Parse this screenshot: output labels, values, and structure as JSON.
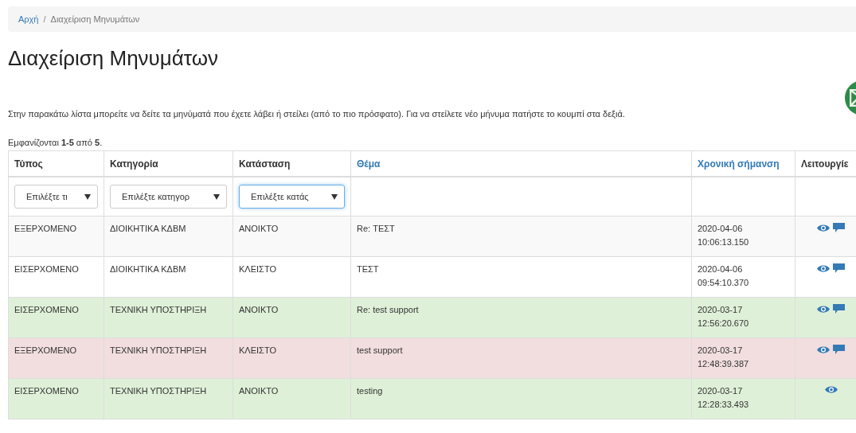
{
  "breadcrumb": [
    {
      "label": "Αρχή",
      "selected": false
    },
    {
      "label": "Διαχείριση Μηνυμάτων",
      "selected": true
    }
  ],
  "breadcrumb_separator": "/",
  "title": "Διαχείριση Μηνυμάτων",
  "intro": "Στην παρακάτω λίστα μπορείτε να δείτε τα μηνύματά που έχετε λάβει ή στείλει (από το πιο πρόσφατο). Για να στείλετε νέο μήνυμα πατήστε το κουμπί στα δεξιά.",
  "summary": "Εμφανίζονται **1-5** από **5**.",
  "table": {
    "columns": [
      {
        "label": "Τύπος",
        "sortable": false
      },
      {
        "label": "Κατηγορία",
        "sortable": false
      },
      {
        "label": "Κατάσταση",
        "sortable": false
      },
      {
        "label": "Θέμα",
        "sortable": true
      },
      {
        "label": "Χρονική σήμανση",
        "sortable": true
      },
      {
        "label": "Λειτουργίε",
        "sortable": false
      }
    ],
    "filters": [
      {
        "placeholder": "Επιλέξτε τι",
        "focused": false
      },
      {
        "placeholder": "Επιλέξτε κατηγορ",
        "focused": false
      },
      {
        "placeholder": "Επιλέξτε κατάς",
        "focused": true
      }
    ],
    "rows": [
      {
        "color": "#f9f9f9",
        "cells": [
          "ΕΞΕΡΧΟΜΕΝΟ",
          "ΔΙΟΙΚΗΤΙΚΑ ΚΔΒΜ",
          "ΑΝΟΙΚΤΟ",
          "Re: ΤΕΣΤ"
        ],
        "date": "2020-04-06",
        "time": "10:06:13.150",
        "actions": [
          {
            "kind": "view"
          },
          {
            "kind": "reply"
          }
        ]
      },
      {
        "color": "#ffffff",
        "cells": [
          "ΕΙΣΕΡΧΟΜΕΝΟ",
          "ΔΙΟΙΚΗΤΙΚΑ ΚΔΒΜ",
          "ΚΛΕΙΣΤΟ",
          "ΤΕΣΤ"
        ],
        "date": "2020-04-06",
        "time": "09:54:10.370",
        "actions": [
          {
            "kind": "view"
          },
          {
            "kind": "reply"
          }
        ]
      },
      {
        "color": "#dff0d8",
        "cells": [
          "ΕΙΣΕΡΧΟΜΕΝΟ",
          "ΤΕΧΝΙΚΗ ΥΠΟΣΤΗΡΙΞΗ",
          "ΑΝΟΙΚΤΟ",
          "Re: test support"
        ],
        "date": "2020-03-17",
        "time": "12:56:20.670",
        "actions": [
          {
            "kind": "view"
          },
          {
            "kind": "reply"
          }
        ]
      },
      {
        "color": "#f2dede",
        "cells": [
          "ΕΞΕΡΧΟΜΕΝΟ",
          "ΤΕΧΝΙΚΗ ΥΠΟΣΤΗΡΙΞΗ",
          "ΚΛΕΙΣΤΟ",
          "test support"
        ],
        "date": "2020-03-17",
        "time": "12:48:39.387",
        "actions": [
          {
            "kind": "view"
          },
          {
            "kind": "reply"
          }
        ]
      },
      {
        "color": "#dff0d8",
        "cells": [
          "ΕΙΣΕΡΧΟΜΕΝΟ",
          "ΤΕΧΝΙΚΗ ΥΠΟΣΤΗΡΙΞΗ",
          "ΑΝΟΙΚΤΟ",
          "testing"
        ],
        "date": "2020-03-17",
        "time": "12:28:33.493",
        "actions": [
          {
            "kind": "view"
          }
        ]
      }
    ]
  }
}
